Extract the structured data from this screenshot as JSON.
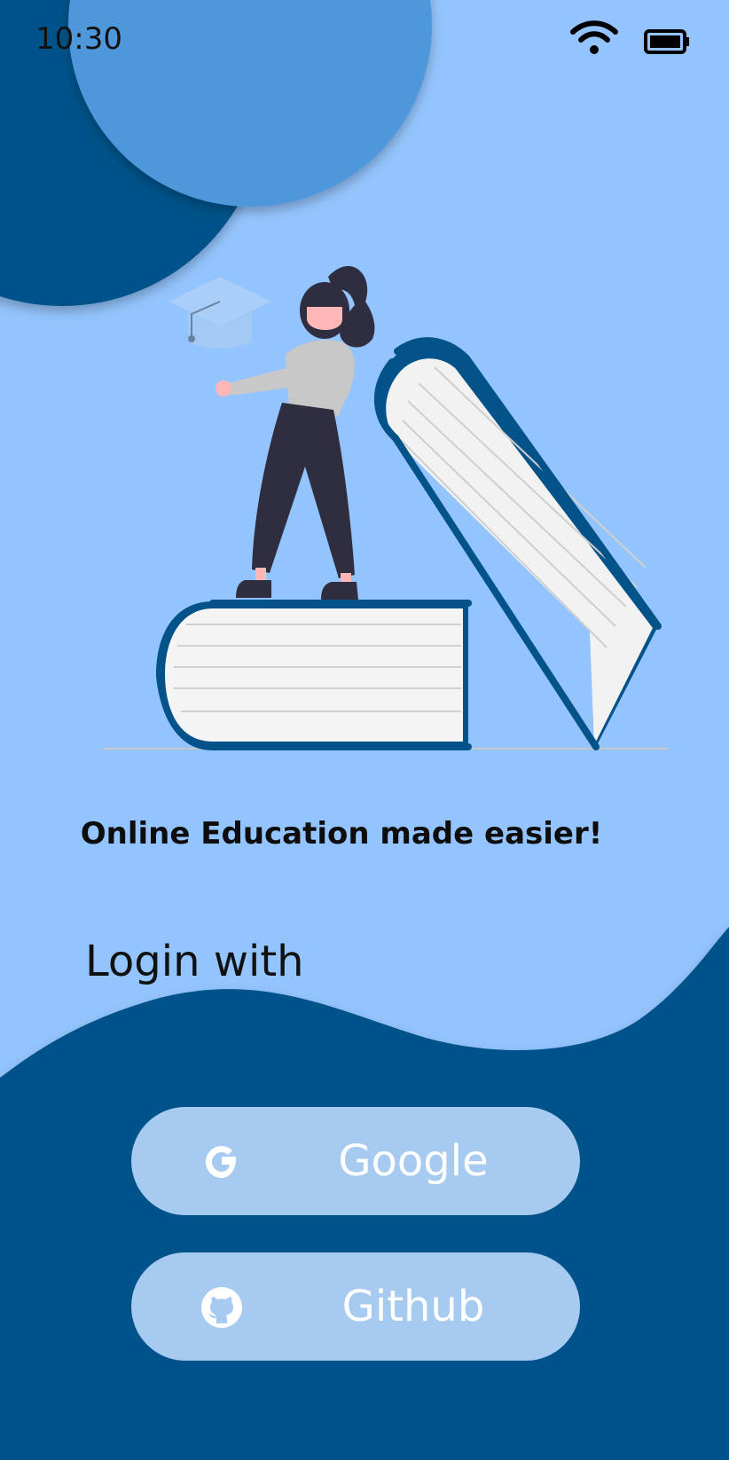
{
  "status_bar": {
    "time": "10:30"
  },
  "hero": {
    "tagline": "Online Education made easier!"
  },
  "login": {
    "heading": "Login with",
    "buttons": [
      {
        "label": "Google",
        "icon": "google-icon"
      },
      {
        "label": "Github",
        "icon": "github-icon"
      }
    ]
  },
  "colors": {
    "background": "#94c4fd",
    "dark_blue": "#04528a",
    "mid_blue": "#5097db",
    "button_fill": "#a7cbf0"
  }
}
